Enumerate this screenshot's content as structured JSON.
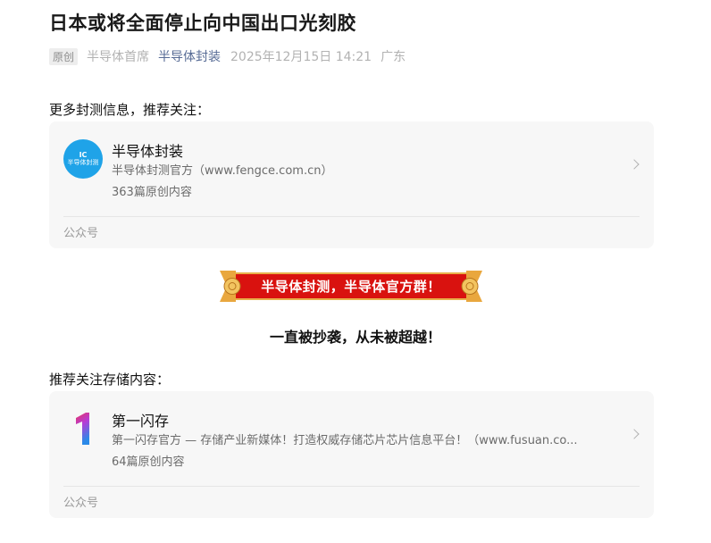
{
  "article": {
    "title": "日本或将全面停止向中国出口光刻胶",
    "original_tag": "原创",
    "author": "半导体首席",
    "account": "半导体封装",
    "datetime": "2025年12月15日 14:21",
    "location": "广东"
  },
  "section1": {
    "heading": "更多封测信息，推荐关注："
  },
  "card1": {
    "avatar_line1": "IC",
    "avatar_line2": "半导体封测",
    "name": "半导体封装",
    "description": "半导体封测官方（www.fengce.com.cn）",
    "count": "363篇原创内容",
    "footer": "公众号",
    "avatar_color": "#1fa3e8"
  },
  "banner": {
    "text": "半导体封测，半导体官方群！",
    "color": "#d9120f"
  },
  "slogan": "一直被抄袭，从未被超越！",
  "section2": {
    "heading": "推荐关注存储内容："
  },
  "card2": {
    "name": "第一闪存",
    "description": "第一闪存官方 — 存储产业新媒体！打造权威存储芯片芯片信息平台！（www.fusuan.co...",
    "count": "64篇原创内容",
    "footer": "公众号"
  }
}
